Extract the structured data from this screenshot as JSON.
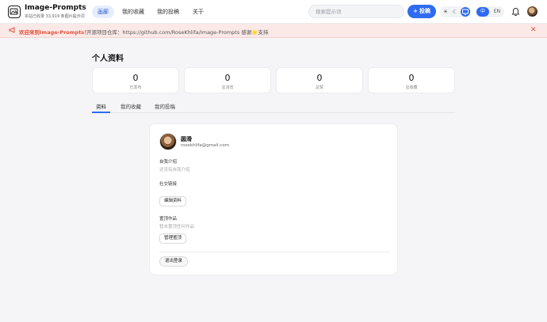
{
  "header": {
    "title": "Image-Prompts",
    "subtitle": "本站已收录 33,919 条图片提示词",
    "nav": [
      {
        "label": "画廊",
        "active": true
      },
      {
        "label": "我的收藏",
        "active": false
      },
      {
        "label": "我的投稿",
        "active": false
      },
      {
        "label": "关于",
        "active": false
      }
    ],
    "search_placeholder": "搜索提示词",
    "post_label": "投稿",
    "theme": {
      "options": [
        "sun-icon",
        "moon-icon",
        "monitor-icon"
      ],
      "active": "monitor-icon"
    },
    "lang": {
      "options": [
        "中",
        "EN"
      ],
      "active": "中"
    },
    "accent_color": "#2f6bf0"
  },
  "banner": {
    "strong": "欢迎来到Image-Prompts！",
    "text": "开源项目仓库：https://github.com/RoseKhlifa/Image-Prompts 感谢🌟支持",
    "close": "✕",
    "color": "#e0523c"
  },
  "profile": {
    "page_title": "个人资料",
    "stats": [
      {
        "value": "0",
        "label": "已发布"
      },
      {
        "value": "0",
        "label": "总浏览"
      },
      {
        "value": "0",
        "label": "总赞"
      },
      {
        "value": "0",
        "label": "总收藏"
      }
    ],
    "tabs": [
      {
        "label": "资料",
        "active": true
      },
      {
        "label": "我的收藏",
        "active": false
      },
      {
        "label": "我的投稿",
        "active": false
      }
    ],
    "name": "圆滑",
    "email": "rosekhlifa@gmail.com",
    "bio_label": "自我介绍",
    "bio_hint": "还没有自我介绍",
    "social_label": "社交链接",
    "edit_btn": "编辑资料",
    "pinned_label": "置顶作品",
    "pinned_hint": "暂未置顶任何作品",
    "manage_btn": "管理置顶",
    "logout_btn": "退出登录"
  }
}
